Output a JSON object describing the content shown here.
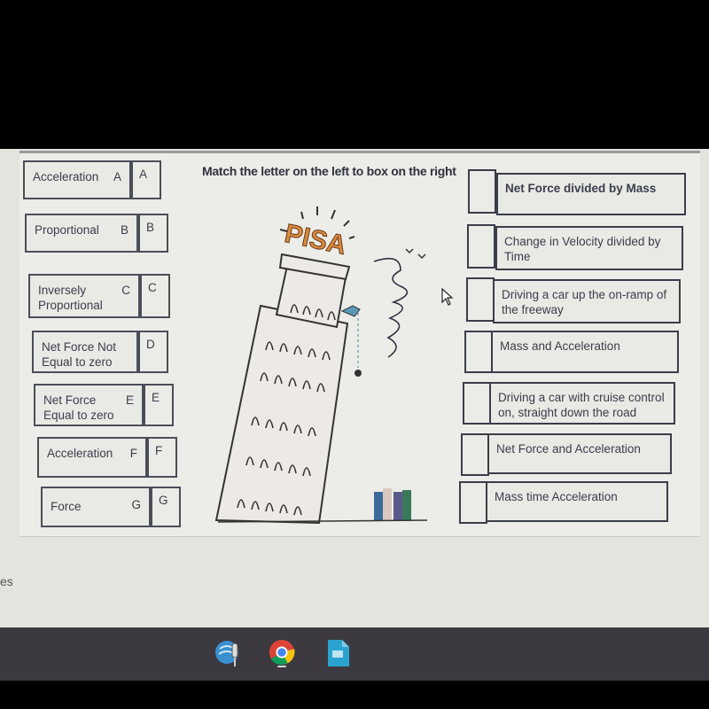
{
  "instruction": "Match the letter on the left to box on the right",
  "left_items": [
    {
      "term": "Acceleration",
      "letter": "A",
      "box_letter": "A"
    },
    {
      "term": "Proportional",
      "letter": "B",
      "box_letter": "B"
    },
    {
      "term": "Inversely Proportional",
      "letter": "C",
      "box_letter": "C"
    },
    {
      "term": "Net Force Not Equal to zero",
      "letter": "D",
      "box_letter": "D"
    },
    {
      "term": "Net Force Equal to zero",
      "letter": "E",
      "box_letter": "E"
    },
    {
      "term": "Acceleration",
      "letter": "F",
      "box_letter": "F"
    },
    {
      "term": "Force",
      "letter": "G",
      "box_letter": "G"
    }
  ],
  "right_items": [
    {
      "definition": "Net Force divided by Mass",
      "answer": ""
    },
    {
      "definition": "Change in Velocity divided by Time",
      "answer": ""
    },
    {
      "definition": "Driving a car up the on-ramp of the freeway",
      "answer": ""
    },
    {
      "definition": "Mass and Acceleration",
      "answer": ""
    },
    {
      "definition": "Driving a car with cruise control on, straight down the road",
      "answer": ""
    },
    {
      "definition": "Net Force and Acceleration",
      "answer": ""
    },
    {
      "definition": "Mass time Acceleration",
      "answer": ""
    }
  ],
  "illustration": {
    "sign_text": "PISA",
    "subject": "leaning-tower-of-pisa-drop-experiment"
  },
  "side_text_fragment": "es",
  "taskbar": {
    "apps": [
      {
        "name": "voice-recorder-icon"
      },
      {
        "name": "chrome-icon",
        "active": true
      },
      {
        "name": "docs-icon"
      }
    ]
  }
}
